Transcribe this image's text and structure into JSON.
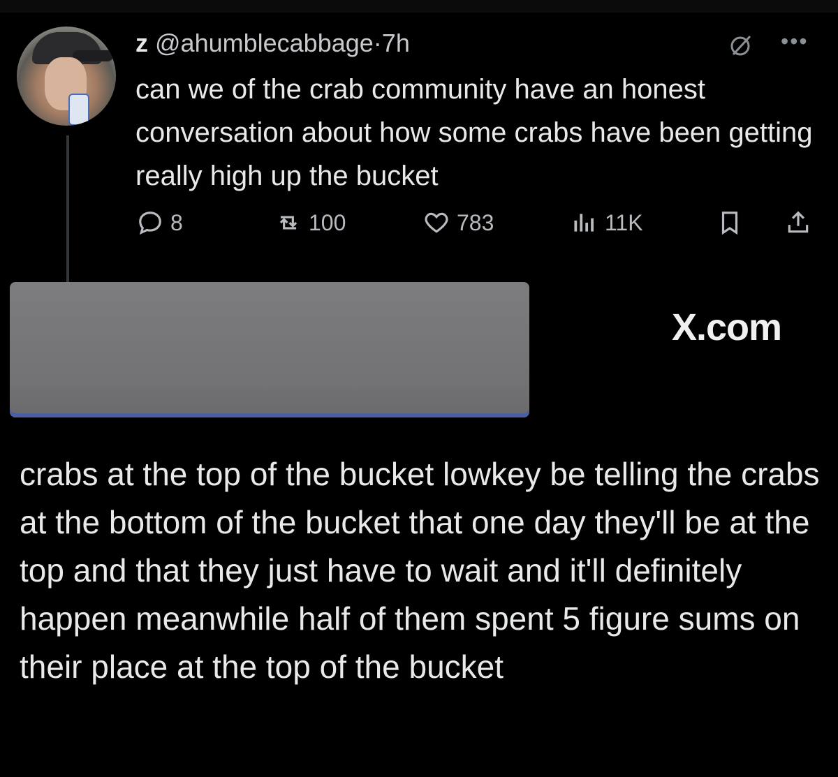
{
  "tweet": {
    "name": "z",
    "handle": "@ahumblecabbage",
    "separator": "·",
    "time": "7h",
    "text": "can we of the crab community have an honest conversation about how some crabs have been getting really high up the bucket",
    "stats": {
      "replies": "8",
      "reposts": "100",
      "likes": "783",
      "views": "11K"
    }
  },
  "overlay": {
    "watermark": "X.com"
  },
  "caption": {
    "text": "crabs at the top of the bucket lowkey be telling the crabs at the bottom of the bucket that one day they'll be at the top and that they just have to wait and it'll definitely happen meanwhile half of them spent 5 figure sums on their place at the top of the bucket"
  },
  "icons": {
    "avatar": "profile-photo",
    "grok": "grok-icon",
    "more": "more-icon",
    "reply": "reply-icon",
    "repost": "repost-icon",
    "like": "heart-icon",
    "views": "views-icon",
    "bookmark": "bookmark-icon",
    "share": "share-icon"
  },
  "colors": {
    "background": "#000000",
    "text": "#e7e9ea",
    "muted": "#b8bbbf",
    "redaction": "#757577"
  }
}
